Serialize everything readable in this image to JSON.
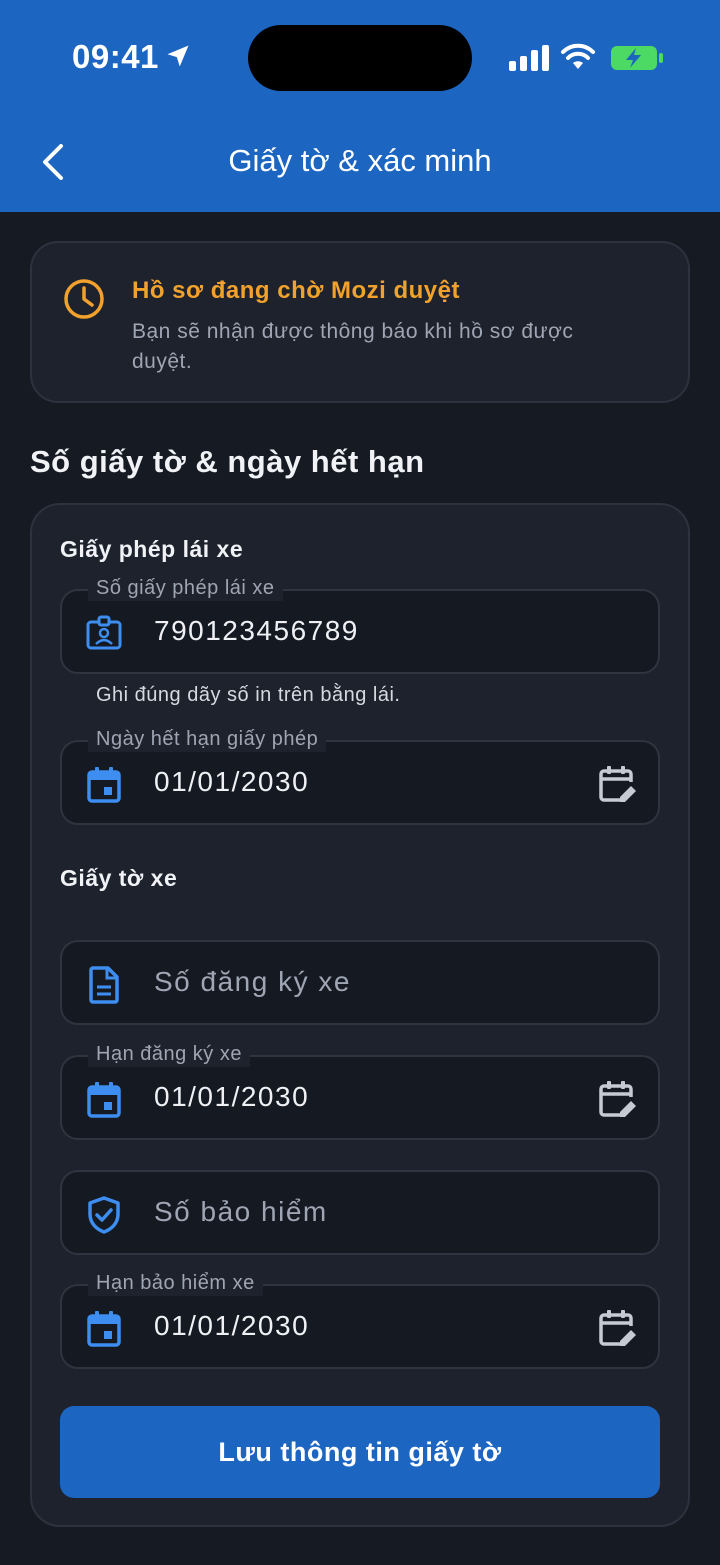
{
  "status_bar": {
    "time": "09:41"
  },
  "header": {
    "title": "Giấy tờ & xác minh"
  },
  "notice": {
    "title": "Hồ sơ đang chờ Mozi duyệt",
    "text": "Bạn sẽ nhận được thông báo khi hồ sơ được duyệt."
  },
  "section_title": "Số giấy tờ & ngày hết hạn",
  "license": {
    "group_label": "Giấy phép lái xe",
    "number_label": "Số giấy phép lái xe",
    "number_value": "790123456789",
    "helper": "Ghi đúng dãy số in trên bằng lái.",
    "expiry_label": "Ngày hết hạn giấy phép",
    "expiry_value": "01/01/2030"
  },
  "vehicle": {
    "group_label": "Giấy tờ xe",
    "registration_placeholder": "Số đăng ký xe",
    "registration_expiry_label": "Hạn đăng ký xe",
    "registration_expiry_value": "01/01/2030",
    "insurance_placeholder": "Số bảo hiểm",
    "insurance_expiry_label": "Hạn bảo hiểm xe",
    "insurance_expiry_value": "01/01/2030"
  },
  "save_button": "Lưu thông tin giấy tờ",
  "colors": {
    "primary": "#1c66c2",
    "warning": "#f2a22c",
    "background": "#161a23",
    "card": "#1e222c",
    "icon_blue": "#3d8ef0"
  }
}
